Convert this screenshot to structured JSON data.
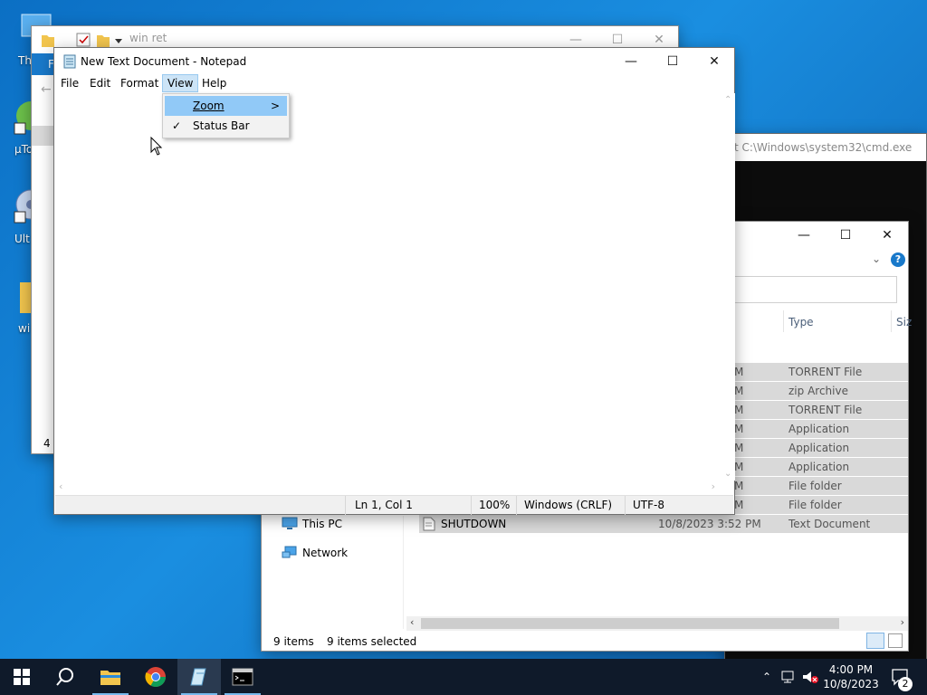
{
  "desktop": {
    "icons": [
      {
        "label": "Thi"
      },
      {
        "label": "µTo"
      },
      {
        "label": "Ult"
      },
      {
        "label": "wi"
      }
    ]
  },
  "explorer_back": {
    "title": "win ret",
    "partial_tab": "F",
    "status": "4 i"
  },
  "cmd": {
    "title": "t C:\\Windows\\system32\\cmd.exe"
  },
  "explorer_front": {
    "columns": {
      "type": "Type",
      "size": "Siz"
    },
    "rows": [
      {
        "date": "M",
        "type": "TORRENT File"
      },
      {
        "date": "M",
        "type": "zip Archive"
      },
      {
        "date": "M",
        "type": "TORRENT File"
      },
      {
        "date": "M",
        "type": "Application"
      },
      {
        "date": "M",
        "type": "Application"
      },
      {
        "date": "M",
        "type": "Application"
      },
      {
        "date": "M",
        "type": "File folder"
      },
      {
        "date": "M",
        "type": "File folder"
      },
      {
        "name": "SHUTDOWN",
        "date": "10/8/2023 3:52 PM",
        "type": "Text Document"
      }
    ],
    "nav": {
      "this_pc": "This PC",
      "network": "Network"
    },
    "status": {
      "items": "9 items",
      "selected": "9 items selected"
    }
  },
  "notepad": {
    "title": "New Text Document - Notepad",
    "menu": {
      "file": "File",
      "edit": "Edit",
      "format": "Format",
      "view": "View",
      "help": "Help"
    },
    "view_menu": {
      "zoom": "Zoom",
      "status_bar": "Status Bar",
      "zoom_arrow": ">",
      "check": "✓"
    },
    "status": {
      "position": "Ln 1, Col 1",
      "zoom": "100%",
      "line_endings": "Windows (CRLF)",
      "encoding": "UTF-8"
    },
    "caption": {
      "minimize": "—",
      "maximize": "☐",
      "close": "✕"
    }
  },
  "taskbar": {
    "time": "4:00 PM",
    "date": "10/8/2023",
    "notification_count": "2"
  },
  "colors": {
    "menu_highlight": "#91c9f7",
    "active_menu": "#cce4f7",
    "desktop_blue": "#1a8ee0",
    "taskbar": "#0f1a2a"
  }
}
